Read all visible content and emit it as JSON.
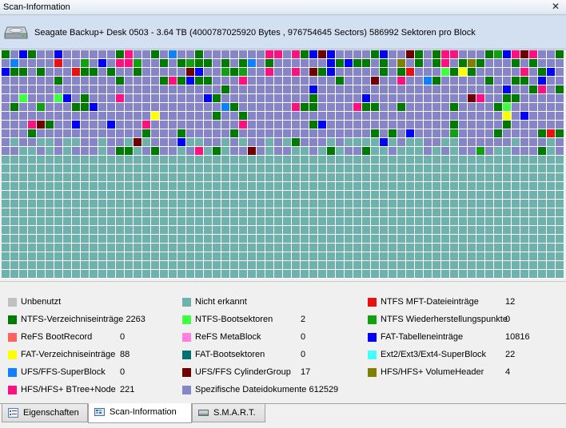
{
  "window": {
    "title": "Scan-Information",
    "close_glyph": "✕"
  },
  "drive": {
    "icon": "hard-drive-icon",
    "description": "Seagate Backup+ Desk 0503 - 3.64 TB (4000787025920 Bytes , 976754645 Sectors) 586992 Sektoren pro Block"
  },
  "sector_map": {
    "columns": 64,
    "rows": 26,
    "background_color": "#8585c8",
    "colors": {
      "unbenutzt": "#c0c0c0",
      "nicht_erkannt": "#6fb1ad",
      "ntfs_mft": "#e81010",
      "ntfs_verzeichnis": "#007a00",
      "ntfs_boot": "#40ff40",
      "ntfs_wiederherstellung": "#10a010",
      "refs_bootrecord": "#ff6060",
      "refs_metablock": "#ff80e0",
      "fat_tabelle": "#0000ff",
      "fat_verzeichnis": "#ffff00",
      "fat_boot": "#007070",
      "ext_superblock": "#40ffff",
      "ufs_superblock": "#1080ff",
      "ufs_cylindergroup": "#700000",
      "hfs_volumeheader": "#808000",
      "hfs_btree": "#ff1080",
      "spezifisch": "#8585c8"
    }
  },
  "legend": [
    {
      "label": "Unbenutzt",
      "count": "",
      "color": "#c0c0c0"
    },
    {
      "label": "Nicht erkannt",
      "count": "",
      "color": "#6fb1ad"
    },
    {
      "label": "NTFS MFT-Dateieinträge",
      "count": "12",
      "color": "#e81010"
    },
    {
      "label": "NTFS-Verzeichniseinträge 2263",
      "count": "",
      "color": "#007a00"
    },
    {
      "label": "NTFS-Bootsektoren",
      "count": "2",
      "color": "#40ff40"
    },
    {
      "label": "NTFS Wiederherstellungspunkte",
      "count": "0",
      "color": "#10a010"
    },
    {
      "label": "ReFS BootRecord",
      "count": "0",
      "color": "#ff6060"
    },
    {
      "label": "ReFS MetaBlock",
      "count": "0",
      "color": "#ff80e0"
    },
    {
      "label": "FAT-Tabelleneinträge",
      "count": "10816",
      "color": "#0000ff"
    },
    {
      "label": "FAT-Verzeichniseinträge",
      "count": "88",
      "color": "#ffff00"
    },
    {
      "label": "FAT-Bootsektoren",
      "count": "0",
      "color": "#007070"
    },
    {
      "label": "Ext2/Ext3/Ext4-SuperBlock",
      "count": "22",
      "color": "#40ffff"
    },
    {
      "label": "UFS/FFS-SuperBlock",
      "count": "0",
      "color": "#1080ff"
    },
    {
      "label": "UFS/FFS CylinderGroup",
      "count": "17",
      "color": "#700000"
    },
    {
      "label": "HFS/HFS+ VolumeHeader",
      "count": "4",
      "color": "#808000"
    },
    {
      "label": "HFS/HFS+ BTree+Node",
      "count": "221",
      "color": "#ff1080"
    },
    {
      "label": "Spezifische Dateidokumente 612529",
      "count": "",
      "color": "#8585c8"
    }
  ],
  "tabs": [
    {
      "label": "Eigenschaften",
      "icon": "properties-icon",
      "active": false
    },
    {
      "label": "Scan-Information",
      "icon": "scan-info-icon",
      "active": true
    },
    {
      "label": "S.M.A.R.T.",
      "icon": "smart-icon",
      "active": false
    }
  ]
}
